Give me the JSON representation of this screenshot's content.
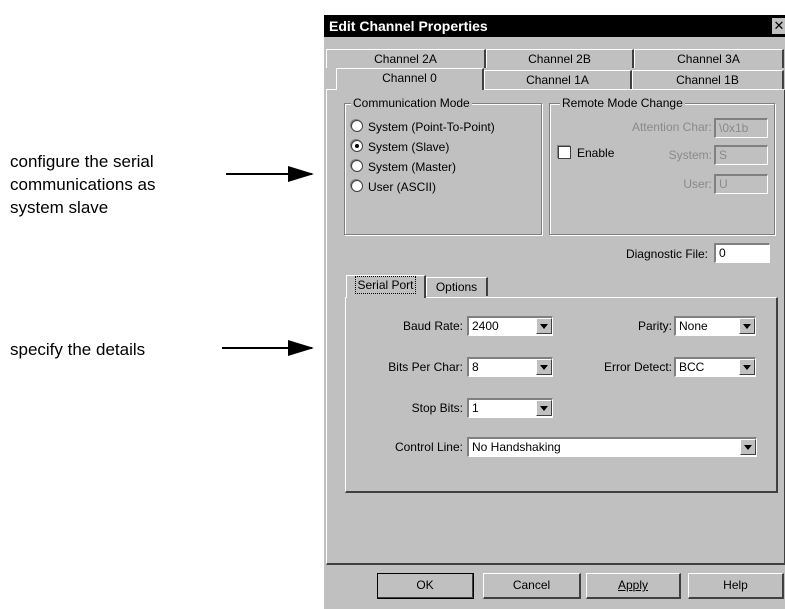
{
  "annotations": {
    "config_line1": "configure the serial",
    "config_line2": "communications as",
    "config_line3": "system slave",
    "details": "specify the details"
  },
  "dialog": {
    "title": "Edit Channel Properties",
    "close_glyph": "✕",
    "tabs_back": [
      "Channel 2A",
      "Channel 2B",
      "Channel 3A"
    ],
    "tabs_front": [
      "Channel 0",
      "Channel 1A",
      "Channel 1B"
    ],
    "selected_tab": "Channel 0",
    "communication_mode": {
      "legend": "Communication Mode",
      "options": [
        "System (Point-To-Point)",
        "System (Slave)",
        "System (Master)",
        "User (ASCII)"
      ],
      "selected": "System (Slave)"
    },
    "remote_mode": {
      "legend": "Remote Mode Change",
      "attention_char_label": "Attention Char:",
      "attention_char_value": "\\0x1b",
      "enable_label": "Enable",
      "enable_checked": false,
      "system_label": "System:",
      "system_value": "S",
      "user_label": "User:",
      "user_value": "U"
    },
    "diagnostic_file": {
      "label": "Diagnostic File:",
      "value": "0"
    },
    "subtabs": [
      "Serial Port",
      "Options"
    ],
    "selected_subtab": "Serial Port",
    "serial": {
      "baud_rate_label": "Baud Rate:",
      "baud_rate": "2400",
      "parity_label": "Parity:",
      "parity": "None",
      "bits_per_char_label": "Bits Per Char:",
      "bits_per_char": "8",
      "error_detect_label": "Error Detect:",
      "error_detect": "BCC",
      "stop_bits_label": "Stop Bits:",
      "stop_bits": "1",
      "control_line_label": "Control Line:",
      "control_line": "No Handshaking"
    },
    "buttons": {
      "ok": "OK",
      "cancel": "Cancel",
      "apply": "Apply",
      "help": "Help"
    }
  }
}
